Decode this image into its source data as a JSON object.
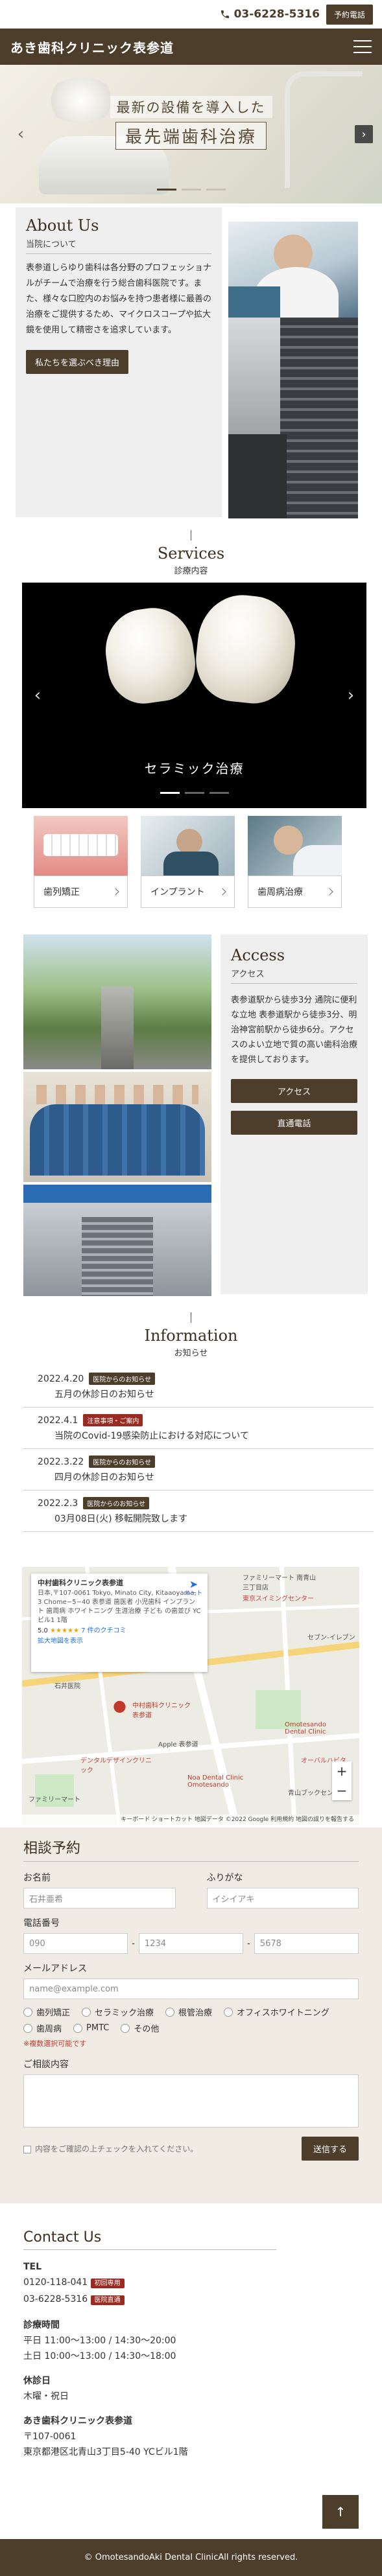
{
  "topbar": {
    "phone": "03-6228-5316",
    "reserve_label": "予約電話"
  },
  "header": {
    "logo": "あき歯科クリニック表参道"
  },
  "hero": {
    "line1": "最新の設備を導入した",
    "line2": "最先端歯科治療",
    "arrow_prev": "‹",
    "arrow_next": "›"
  },
  "about": {
    "title": "About Us",
    "subtitle": "当院について",
    "text": "表参道しらゆり歯科は各分野のプロフェッショナルがチームで治療を行う総合歯科医院です。また、様々な口腔内のお悩みを持つ患者様に最善の治療をご提供するため、マイクロスコープや拡大鏡を使用して精密さを追求しています。",
    "button": "私たちを選ぶべき理由"
  },
  "services": {
    "title": "Services",
    "subtitle": "診療内容",
    "slide_label": "セラミック治療",
    "cards": [
      {
        "label": "歯列矯正"
      },
      {
        "label": "インプラント"
      },
      {
        "label": "歯周病治療"
      }
    ]
  },
  "access": {
    "title": "Access",
    "subtitle": "アクセス",
    "text": "表参道駅から徒歩3分 通院に便利な立地 表参道駅から徒歩3分、明治神宮前駅から徒歩6分。アクセスのよい立地で質の高い歯科治療を提供しております。",
    "btn_access": "アクセス",
    "btn_phone": "直通電話"
  },
  "info": {
    "title": "Information",
    "subtitle": "お知らせ",
    "items": [
      {
        "date": "2022.4.20",
        "tag": "医院からのお知らせ",
        "text": "五月の休診日のお知らせ"
      },
      {
        "date": "2022.4.1",
        "tag": "注意事項・ご案内",
        "text": "当院のCovid-19感染防止における対応について"
      },
      {
        "date": "2022.3.22",
        "tag": "医院からのお知らせ",
        "text": "四月の休診日のお知らせ"
      },
      {
        "date": "2022.2.3",
        "tag": "医院からのお知らせ",
        "text": "03月08日(火) 移転開院致します"
      }
    ]
  },
  "map": {
    "card_title": "中村歯科クリニック表参道",
    "card_address": "日本,〒107-0061 Tokyo, Minato City, Kitaaoyama, 3 Chome−5−40 表参道 歯医者 小児歯科 インプラント 歯周病 ホワイトニング 生涯治療 子ども の歯並び YCビル1 1階",
    "rating": "5.0",
    "stars": "★★★★★",
    "reviews": "7 件のクチコミ",
    "enlarge": "拡大地図を表示",
    "route": "ルート",
    "marker1": "Omotesando Dental Clinic",
    "marker2": "Noa Dental Clinic Omotesando",
    "marker3": "中村歯科クリニック表参道",
    "labels": [
      "石井医院",
      "ファミリーマート 南青山三丁目店",
      "東京スイミングセンター",
      "デンタルデザインクリニック",
      "オーバルハビタ",
      "セブン-イレブン",
      "ファミリーマート",
      "青山ブックセンター",
      "Apple 表参道"
    ],
    "footer": "キーボード ショートカット   地図データ ©2022 Google   利用規約   地図の誤りを報告する",
    "zoom_in": "+",
    "zoom_out": "−"
  },
  "form": {
    "title": "相談予約",
    "name_label": "お名前",
    "name_placeholder": "石井亜希",
    "kana_label": "ふりがな",
    "kana_placeholder": "イシイアキ",
    "tel_label": "電話番号",
    "tel1": "090",
    "tel2": "1234",
    "tel3": "5678",
    "email_label": "メールアドレス",
    "email_placeholder": "name@example.com",
    "options": [
      "歯列矯正",
      "セラミック治療",
      "根管治療",
      "オフィスホワイトニング",
      "歯周病",
      "PMTC",
      "その他"
    ],
    "note": "※複数選択可能です",
    "message_label": "ご相談内容",
    "confirm": "内容をご確認の上チェックを入れてください。",
    "send": "送信する"
  },
  "contact": {
    "title": "Contact Us",
    "tel_h": "TEL",
    "tel1": "0120-118-041",
    "tel1_tag": "初回専用",
    "tel2": "03-6228-5316",
    "tel2_tag": "医院直通",
    "hours_h": "診療時間",
    "hours1": "平日 11:00～13:00 / 14:30～20:00",
    "hours2": "土日 10:00～13:00 / 14:30～18:00",
    "closed_h": "休診日",
    "closed": "木曜・祝日",
    "name": "あき歯科クリニック表参道",
    "zip": "〒107-0061",
    "address": "東京都港区北青山3丁目5-40 YCビル1階"
  },
  "footer": {
    "copyright": "© OmotesandoAki Dental ClinicAll rights reserved."
  },
  "totop": "↑",
  "colors": {
    "brand": "#4d3e2c",
    "panel": "#efefef",
    "form_bg": "#f0ece3",
    "alert": "#9b2a22"
  }
}
